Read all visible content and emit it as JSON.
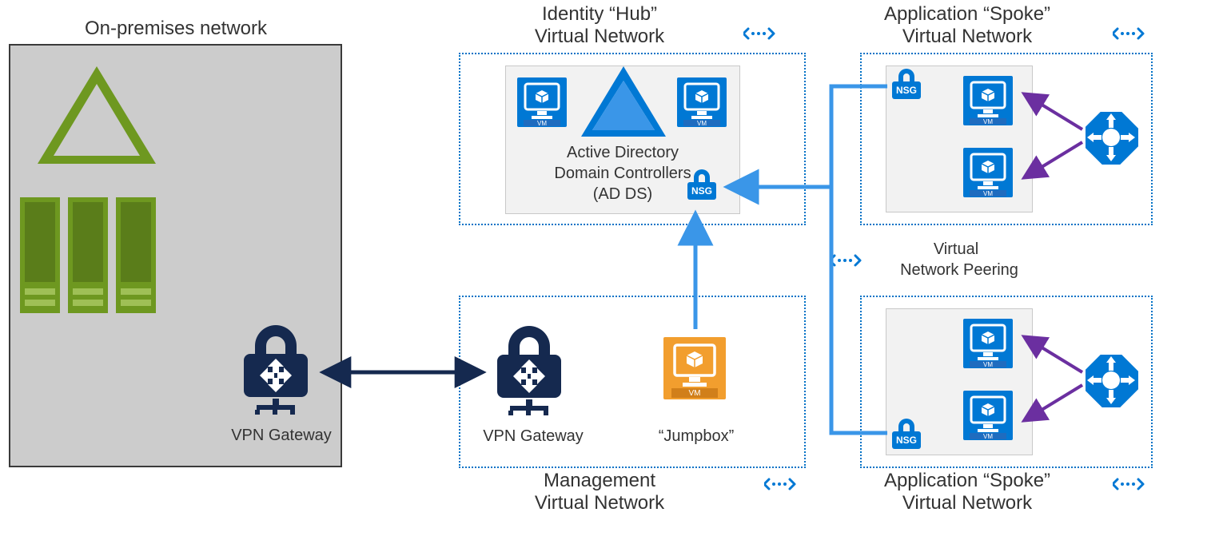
{
  "titles": {
    "onprem": "On-premises network",
    "hub": "Identity “Hub”\nVirtual Network",
    "spoke_top": "Application “Spoke”\nVirtual Network",
    "mgmt": "Management\nVirtual Network",
    "spoke_bottom": "Application “Spoke”\nVirtual Network"
  },
  "labels": {
    "vpn_onprem": "VPN Gateway",
    "vpn_azure": "VPN Gateway",
    "jumpbox": "“Jumpbox”",
    "adds_line1": "Active Directory",
    "adds_line2": "Domain Controllers",
    "adds_line3": "(AD DS)",
    "peering_line1": "Virtual",
    "peering_line2": "Network Peering",
    "nsg": "NSG",
    "vm": "VM"
  },
  "colors": {
    "azure_blue": "#0078d4",
    "azure_blue_dark": "#1f6cbf",
    "navy": "#15294f",
    "green": "#6b8e23",
    "orange": "#f29e2e",
    "purple": "#6b2fa0",
    "gray_bg": "#cccccc"
  }
}
